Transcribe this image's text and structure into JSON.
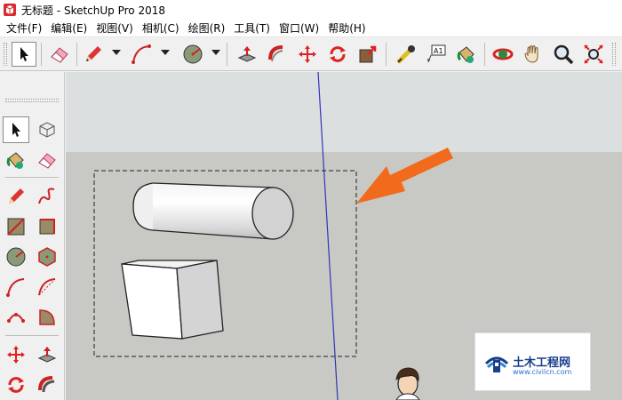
{
  "window": {
    "title": "无标题 - SketchUp Pro 2018",
    "app_icon": "sketchup-logo"
  },
  "menu": [
    {
      "label": "文件(F)"
    },
    {
      "label": "编辑(E)"
    },
    {
      "label": "视图(V)"
    },
    {
      "label": "相机(C)"
    },
    {
      "label": "绘图(R)"
    },
    {
      "label": "工具(T)"
    },
    {
      "label": "窗口(W)"
    },
    {
      "label": "帮助(H)"
    }
  ],
  "toolbar": {
    "tools": [
      {
        "id": "select",
        "icon": "arrow-cursor-icon",
        "active": true
      },
      {
        "id": "eraser",
        "icon": "eraser-icon"
      },
      {
        "id": "line",
        "icon": "pencil-icon",
        "has_dropdown": true
      },
      {
        "id": "arc",
        "icon": "arc-icon",
        "has_dropdown": true
      },
      {
        "id": "circle",
        "icon": "circle-icon",
        "has_dropdown": true
      },
      {
        "id": "push-pull",
        "icon": "push-pull-icon"
      },
      {
        "id": "follow-me",
        "icon": "follow-me-icon"
      },
      {
        "id": "move",
        "icon": "move-icon"
      },
      {
        "id": "rotate",
        "icon": "rotate-icon"
      },
      {
        "id": "scale",
        "icon": "scale-icon"
      },
      {
        "id": "tape-measure",
        "icon": "tape-measure-icon"
      },
      {
        "id": "text",
        "icon": "text-icon",
        "label": "A1"
      },
      {
        "id": "paint-bucket",
        "icon": "paint-bucket-icon"
      },
      {
        "id": "orbit",
        "icon": "orbit-icon"
      },
      {
        "id": "pan",
        "icon": "hand-icon"
      },
      {
        "id": "zoom",
        "icon": "magnifier-icon"
      },
      {
        "id": "zoom-extents",
        "icon": "zoom-extents-icon"
      }
    ]
  },
  "left_toolbar": {
    "tools": [
      {
        "id": "select",
        "icon": "arrow-cursor-icon",
        "active": true
      },
      {
        "id": "make-component",
        "icon": "component-icon"
      },
      {
        "id": "paint-bucket",
        "icon": "paint-bucket-icon"
      },
      {
        "id": "eraser",
        "icon": "eraser-icon"
      },
      {
        "id": "line",
        "icon": "pencil-icon"
      },
      {
        "id": "freehand",
        "icon": "freehand-icon"
      },
      {
        "id": "rectangle",
        "icon": "rectangle-icon"
      },
      {
        "id": "rotated-rectangle",
        "icon": "rotated-rectangle-icon"
      },
      {
        "id": "circle",
        "icon": "circle-icon"
      },
      {
        "id": "polygon",
        "icon": "polygon-icon"
      },
      {
        "id": "arc",
        "icon": "arc-icon"
      },
      {
        "id": "two-point-arc",
        "icon": "two-point-arc-icon"
      },
      {
        "id": "three-point-arc",
        "icon": "three-point-arc-icon"
      },
      {
        "id": "pie",
        "icon": "pie-icon"
      },
      {
        "id": "move",
        "icon": "move-icon"
      },
      {
        "id": "push-pull",
        "icon": "push-pull-icon"
      },
      {
        "id": "rotate",
        "icon": "rotate-icon"
      },
      {
        "id": "follow-me",
        "icon": "follow-me-icon"
      }
    ]
  },
  "viewport": {
    "sky_color": "#dcdfe0",
    "ground_color": "#c8c9c4",
    "axis_color": "#3333bb",
    "selection_box": "dashed",
    "objects": [
      "cylinder",
      "cube"
    ],
    "annotation": "orange-arrow"
  },
  "watermark": {
    "title": "土木工程网",
    "url": "www.civilcn.com"
  },
  "colors": {
    "accent_red": "#cc2a2a",
    "accent_orange": "#f26a1b",
    "brand_blue": "#1a3e8c"
  }
}
